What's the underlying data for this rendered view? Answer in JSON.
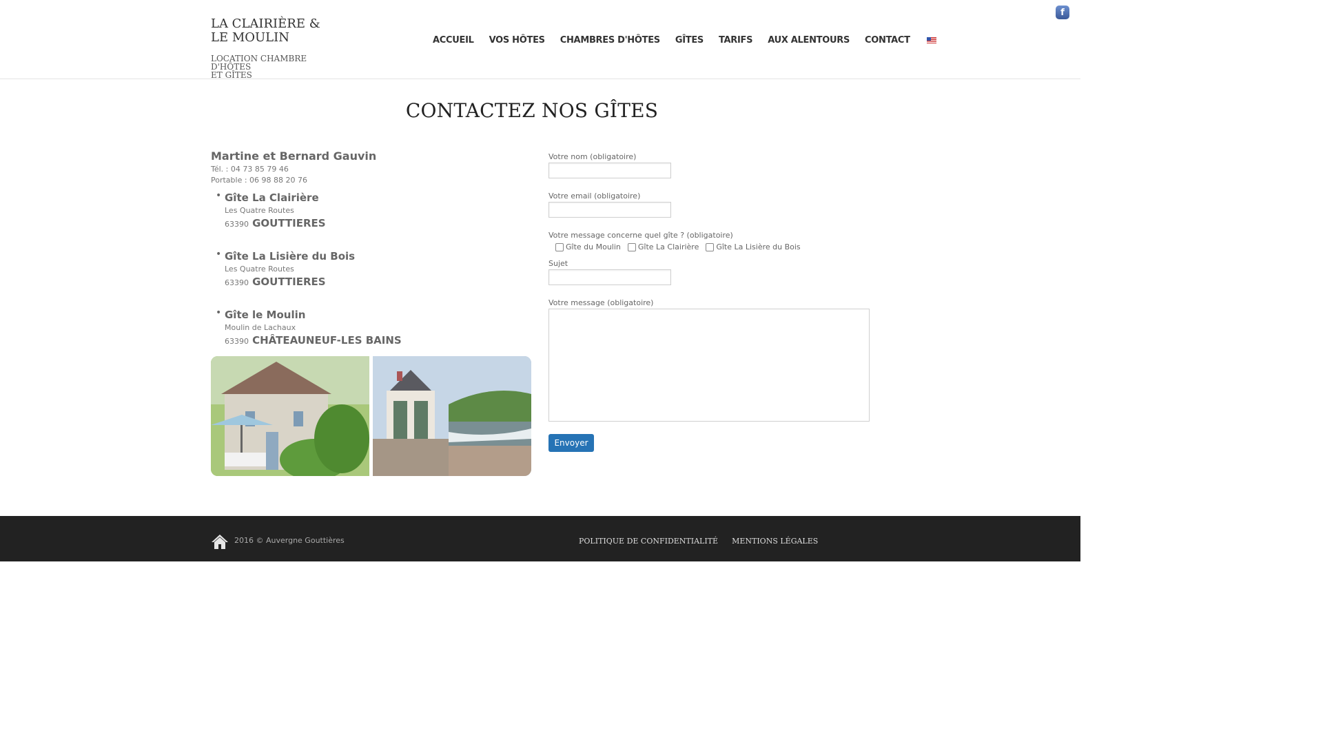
{
  "site": {
    "title_line1": "LA CLAIRIÈRE &",
    "title_line2": "LE MOULIN",
    "tagline_line1": "LOCATION CHAMBRE D'HÔTES",
    "tagline_line2": "ET GÎTES"
  },
  "nav": {
    "items": [
      "ACCUEIL",
      "VOS HÔTES",
      "CHAMBRES D'HÔTES",
      "GÎTES",
      "TARIFS",
      "AUX ALENTOURS",
      "CONTACT"
    ],
    "language_icon": "us-flag-icon"
  },
  "social": {
    "icon": "facebook-icon",
    "glyph": "f"
  },
  "page": {
    "title": "CONTACTEZ NOS GÎTES"
  },
  "contact": {
    "name": "Martine et Bernard Gauvin",
    "tel": "Tél. : 04 73 85 79 46",
    "mobile": "Portable : 06 98 88 20 76"
  },
  "gites": [
    {
      "name": "Gîte La Clairière",
      "street": "Les Quatre Routes",
      "zip": "63390",
      "city": "GOUTTIERES"
    },
    {
      "name": "Gîte La Lisière du Bois",
      "street": "Les Quatre Routes",
      "zip": "63390",
      "city": "GOUTTIERES"
    },
    {
      "name": "Gîte le Moulin",
      "street": "Moulin de Lachaux",
      "zip": "63390",
      "city": "CHÂTEAUNEUF-LES BAINS"
    }
  ],
  "form": {
    "name_label": "Votre nom (obligatoire)",
    "email_label": "Votre email (obligatoire)",
    "gite_question": "Votre message concerne quel gîte ? (obligatoire)",
    "gite_options": [
      "Gîte du Moulin",
      "Gîte La Clairière",
      "Gîte La Lisière du Bois"
    ],
    "subject_label": "Sujet",
    "message_label": "Votre message (obligatoire)",
    "submit_label": "Envoyer"
  },
  "footer": {
    "copyright": "2016 © Auvergne Gouttières",
    "links": [
      "POLITIQUE DE CONFIDENTIALITÉ",
      "MENTIONS LÉGALES"
    ]
  }
}
